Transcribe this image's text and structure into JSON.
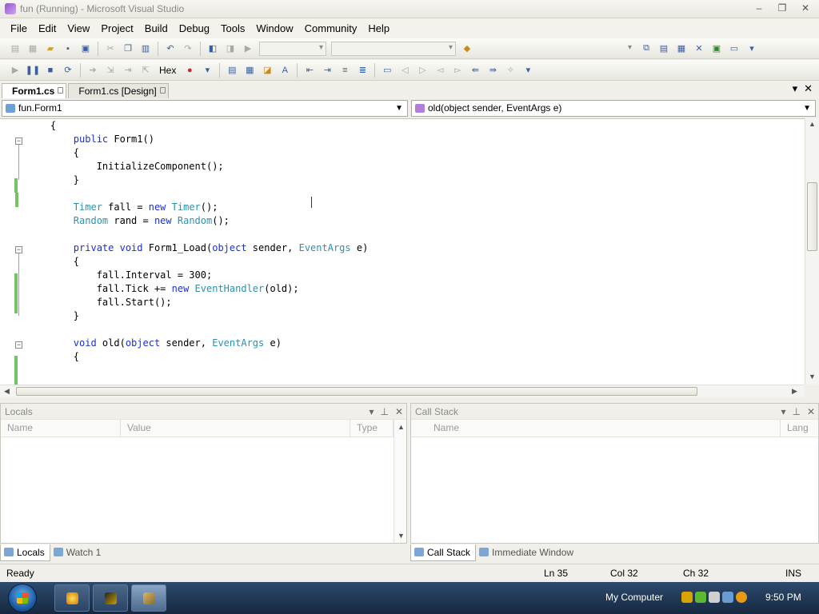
{
  "window": {
    "title": "fun (Running) - Microsoft Visual Studio",
    "controls": [
      "–",
      "❐",
      "✕"
    ]
  },
  "menu": [
    "File",
    "Edit",
    "View",
    "Project",
    "Build",
    "Debug",
    "Tools",
    "Window",
    "Community",
    "Help"
  ],
  "toolbar": {
    "hex_label": "Hex"
  },
  "doc_tabs": [
    {
      "label": "Form1.cs",
      "active": true
    },
    {
      "label": "Form1.cs [Design]",
      "active": false
    }
  ],
  "nav": {
    "type_dropdown": "fun.Form1",
    "member_dropdown": "old(object sender, EventArgs e)"
  },
  "code_lines": [
    [
      {
        "t": "    {",
        "c": ""
      }
    ],
    [
      {
        "t": "        ",
        "c": ""
      },
      {
        "t": "public",
        "c": "kw"
      },
      {
        "t": " Form1()",
        "c": ""
      }
    ],
    [
      {
        "t": "        {",
        "c": ""
      }
    ],
    [
      {
        "t": "            InitializeComponent();",
        "c": ""
      }
    ],
    [
      {
        "t": "        }",
        "c": ""
      }
    ],
    [
      {
        "t": "",
        "c": ""
      }
    ],
    [
      {
        "t": "        ",
        "c": ""
      },
      {
        "t": "Timer",
        "c": "ty"
      },
      {
        "t": " fall = ",
        "c": ""
      },
      {
        "t": "new",
        "c": "kw"
      },
      {
        "t": " ",
        "c": ""
      },
      {
        "t": "Timer",
        "c": "ty"
      },
      {
        "t": "();",
        "c": ""
      }
    ],
    [
      {
        "t": "        ",
        "c": ""
      },
      {
        "t": "Random",
        "c": "ty"
      },
      {
        "t": " rand = ",
        "c": ""
      },
      {
        "t": "new",
        "c": "kw"
      },
      {
        "t": " ",
        "c": ""
      },
      {
        "t": "Random",
        "c": "ty"
      },
      {
        "t": "();",
        "c": ""
      }
    ],
    [
      {
        "t": "",
        "c": ""
      }
    ],
    [
      {
        "t": "        ",
        "c": ""
      },
      {
        "t": "private",
        "c": "kw"
      },
      {
        "t": " ",
        "c": ""
      },
      {
        "t": "void",
        "c": "kw"
      },
      {
        "t": " Form1_Load(",
        "c": ""
      },
      {
        "t": "object",
        "c": "kw"
      },
      {
        "t": " sender, ",
        "c": ""
      },
      {
        "t": "EventArgs",
        "c": "ty"
      },
      {
        "t": " e)",
        "c": ""
      }
    ],
    [
      {
        "t": "        {",
        "c": ""
      }
    ],
    [
      {
        "t": "            fall.Interval = 300;",
        "c": ""
      }
    ],
    [
      {
        "t": "            fall.Tick += ",
        "c": ""
      },
      {
        "t": "new",
        "c": "kw"
      },
      {
        "t": " ",
        "c": ""
      },
      {
        "t": "EventHandler",
        "c": "ty"
      },
      {
        "t": "(old);",
        "c": ""
      }
    ],
    [
      {
        "t": "            fall.Start();",
        "c": ""
      }
    ],
    [
      {
        "t": "        }",
        "c": ""
      }
    ],
    [
      {
        "t": "",
        "c": ""
      }
    ],
    [
      {
        "t": "        ",
        "c": ""
      },
      {
        "t": "void",
        "c": "kw"
      },
      {
        "t": " old(",
        "c": ""
      },
      {
        "t": "object",
        "c": "kw"
      },
      {
        "t": " sender, ",
        "c": ""
      },
      {
        "t": "EventArgs",
        "c": "ty"
      },
      {
        "t": " e)",
        "c": ""
      }
    ],
    [
      {
        "t": "        {",
        "c": ""
      }
    ]
  ],
  "locals_panel": {
    "title": "Locals",
    "columns": [
      "Name",
      "Value",
      "Type"
    ]
  },
  "callstack_panel": {
    "title": "Call Stack",
    "columns": [
      "Name",
      "Lang"
    ]
  },
  "left_tabs": [
    {
      "label": "Locals",
      "active": true
    },
    {
      "label": "Watch 1",
      "active": false
    }
  ],
  "right_tabs": [
    {
      "label": "Call Stack",
      "active": true
    },
    {
      "label": "Immediate Window",
      "active": false
    }
  ],
  "status": {
    "ready": "Ready",
    "ln": "Ln 35",
    "col": "Col 32",
    "ch": "Ch 32",
    "mode": "INS"
  },
  "taskbar": {
    "tray_label": "My Computer",
    "clock": "9:50 PM"
  },
  "colors": {
    "keyword": "#1a30d0",
    "type": "#2b91af",
    "change_bar": "#75c464"
  }
}
